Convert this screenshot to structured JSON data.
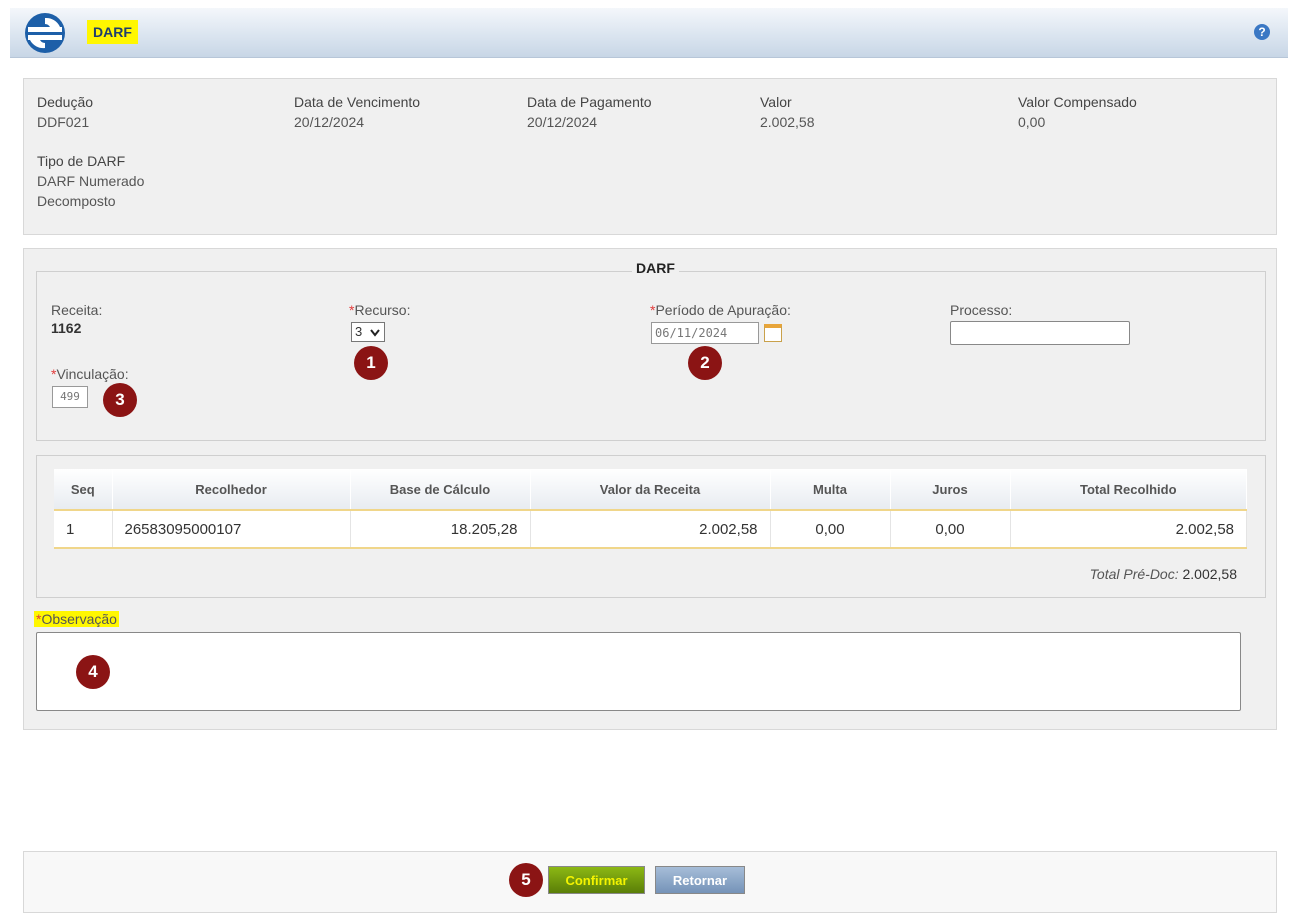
{
  "header": {
    "title": "DARF",
    "help_icon": "?"
  },
  "info": {
    "deducao": {
      "label": "Dedução",
      "value": "DDF021"
    },
    "vencimento": {
      "label": "Data de Vencimento",
      "value": "20/12/2024"
    },
    "pagamento": {
      "label": "Data de Pagamento",
      "value": "20/12/2024"
    },
    "valor": {
      "label": "Valor",
      "value": "2.002,58"
    },
    "compensado": {
      "label": "Valor Compensado",
      "value": "0,00"
    },
    "tipo": {
      "label": "Tipo de DARF",
      "value_line1": "DARF Numerado",
      "value_line2": "Decomposto"
    }
  },
  "form": {
    "legend": "DARF",
    "receita": {
      "label": "Receita:",
      "value": "1162"
    },
    "recurso": {
      "label": "Recurso:",
      "value": "3"
    },
    "periodo": {
      "label": "Período de Apuração:",
      "value": "06/11/2024"
    },
    "processo": {
      "label": "Processo:",
      "value": ""
    },
    "vinculacao": {
      "label": "Vinculação:",
      "value": "499"
    },
    "required_mark": "*"
  },
  "markers": [
    "1",
    "2",
    "3",
    "4",
    "5"
  ],
  "table": {
    "headers": [
      "Seq",
      "Recolhedor",
      "Base de Cálculo",
      "Valor da Receita",
      "Multa",
      "Juros",
      "Total Recolhido"
    ],
    "rows": [
      [
        "1",
        "26583095000107",
        "18.205,28",
        "2.002,58",
        "0,00",
        "0,00",
        "2.002,58"
      ]
    ],
    "total_label": "Total Pré-Doc:",
    "total_value": "2.002,58"
  },
  "observacao": {
    "label": "Observação",
    "value": ""
  },
  "buttons": {
    "confirm": "Confirmar",
    "return": "Retornar"
  },
  "colors": {
    "marker": "#8b1414",
    "highlight": "#fff700",
    "confirm_text": "#f4f400"
  }
}
